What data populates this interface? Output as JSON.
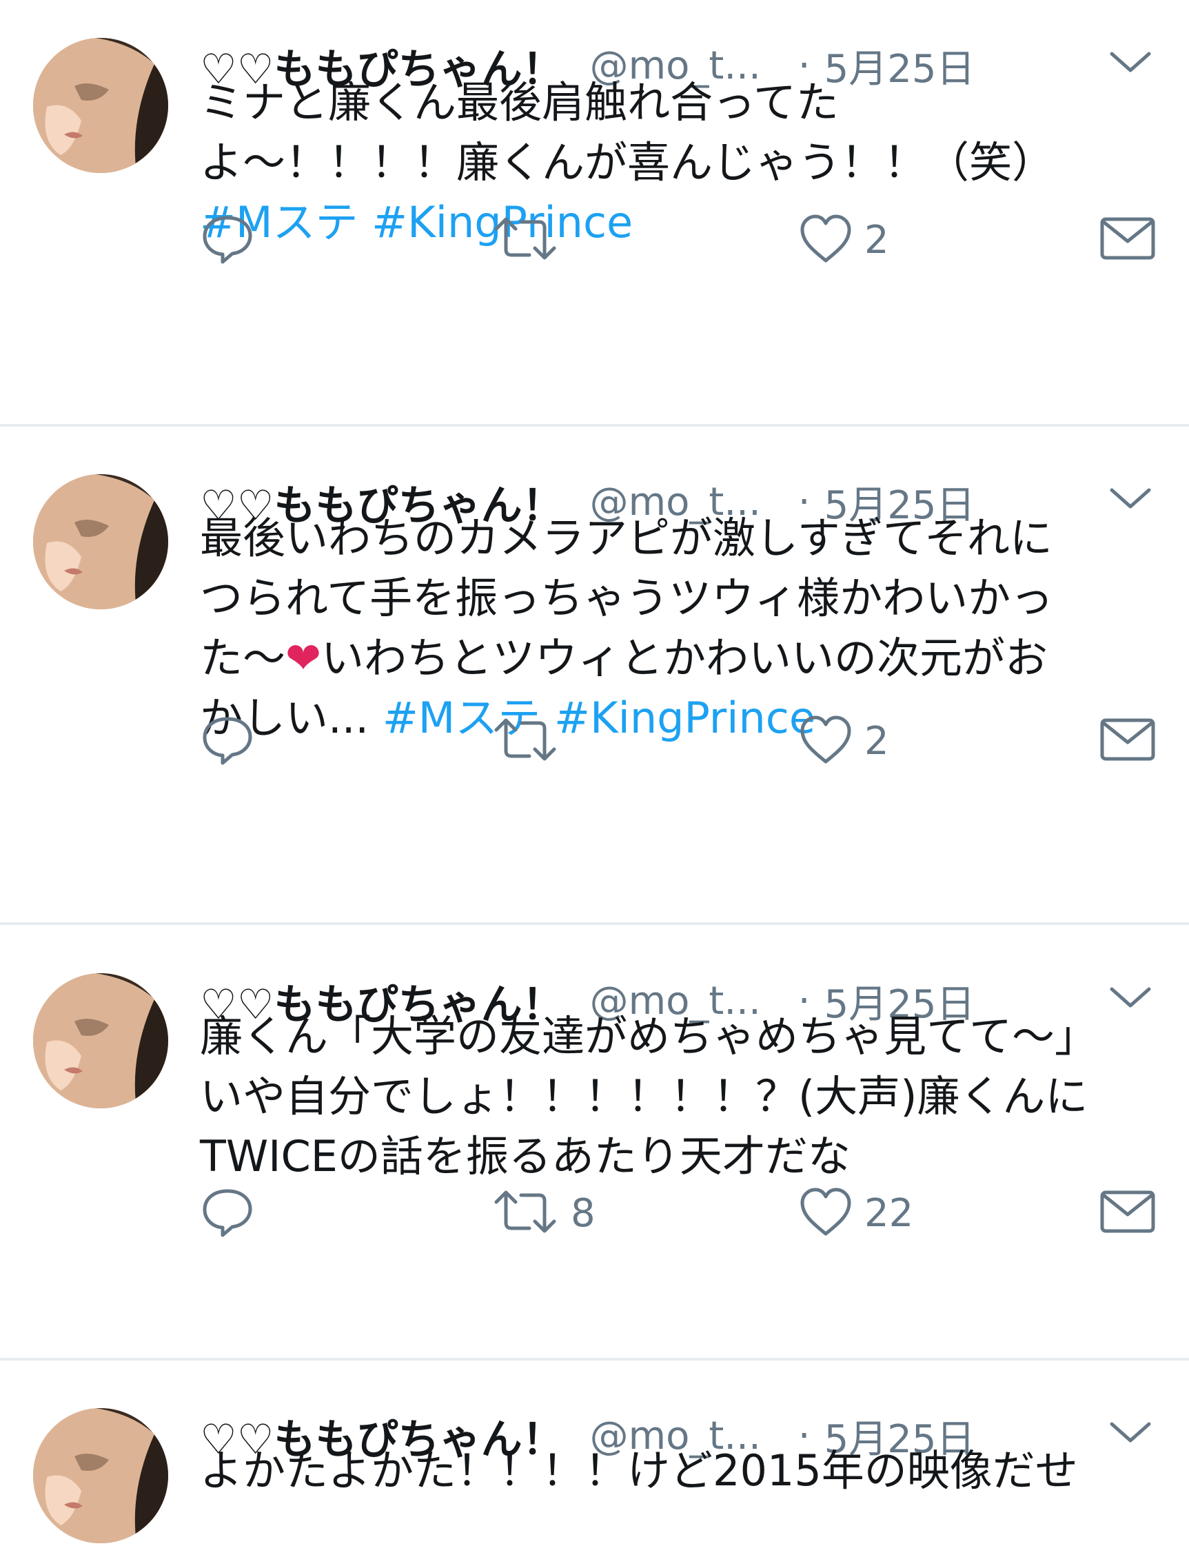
{
  "colors": {
    "text_primary": "#14171a",
    "text_secondary": "#657786",
    "link": "#1da1f2",
    "divider": "#e6ecf0",
    "heart_emoji": "#e0245e"
  },
  "tweets": [
    {
      "name": "♡♡ももぴちゃん！",
      "handle": "@mo_t...",
      "dot": "·",
      "date": "5月25日",
      "lines": [
        [
          {
            "text": "ミナと廉くん最後肩触れ合ってた"
          }
        ],
        [
          {
            "text": "よ〜！！！！廉くんが喜んじゃう！！（笑）"
          }
        ],
        [
          {
            "text": "#Mステ",
            "hashtag": true
          },
          {
            "text": " "
          },
          {
            "text": "#KingPrince",
            "hashtag": true
          }
        ]
      ],
      "reply_count": "",
      "retweet_count": "",
      "like_count": "2"
    },
    {
      "name": "♡♡ももぴちゃん！",
      "handle": "@mo_t...",
      "dot": "·",
      "date": "5月25日",
      "lines": [
        [
          {
            "text": "最後いわちのカメラアピが激しすぎてそれに"
          }
        ],
        [
          {
            "text": "つられて手を振っちゃうツウィ様かわいかっ"
          }
        ],
        [
          {
            "text": "た〜"
          },
          {
            "text": "❤",
            "emoji": true
          },
          {
            "text": "いわちとツウィとかわいいの次元がお"
          }
        ],
        [
          {
            "text": "かしい... "
          },
          {
            "text": "#Mステ",
            "hashtag": true
          },
          {
            "text": " "
          },
          {
            "text": "#KingPrince",
            "hashtag": true
          }
        ]
      ],
      "reply_count": "",
      "retweet_count": "",
      "like_count": "2"
    },
    {
      "name": "♡♡ももぴちゃん！",
      "handle": "@mo_t...",
      "dot": "·",
      "date": "5月25日",
      "lines": [
        [
          {
            "text": "廉くん「大学の友達がめちゃめちゃ見てて〜」"
          }
        ],
        [
          {
            "text": "いや自分でしょ！！！！！！？(大声)廉くんに"
          }
        ],
        [
          {
            "text": "TWICEの話を振るあたり天才だな"
          }
        ]
      ],
      "reply_count": "",
      "retweet_count": "8",
      "like_count": "22"
    },
    {
      "name": "♡♡ももぴちゃん！",
      "handle": "@mo_t...",
      "dot": "·",
      "date": "5月25日",
      "lines": [
        [
          {
            "text": "よかたよかた！！！！けど2015年の映像だせ"
          }
        ]
      ],
      "reply_count": "",
      "retweet_count": "",
      "like_count": ""
    }
  ],
  "icons": {
    "avatar": "avatar-photo",
    "caret": "chevron-down-icon",
    "reply": "reply-icon",
    "retweet": "retweet-icon",
    "like": "heart-icon",
    "dm": "envelope-icon"
  }
}
